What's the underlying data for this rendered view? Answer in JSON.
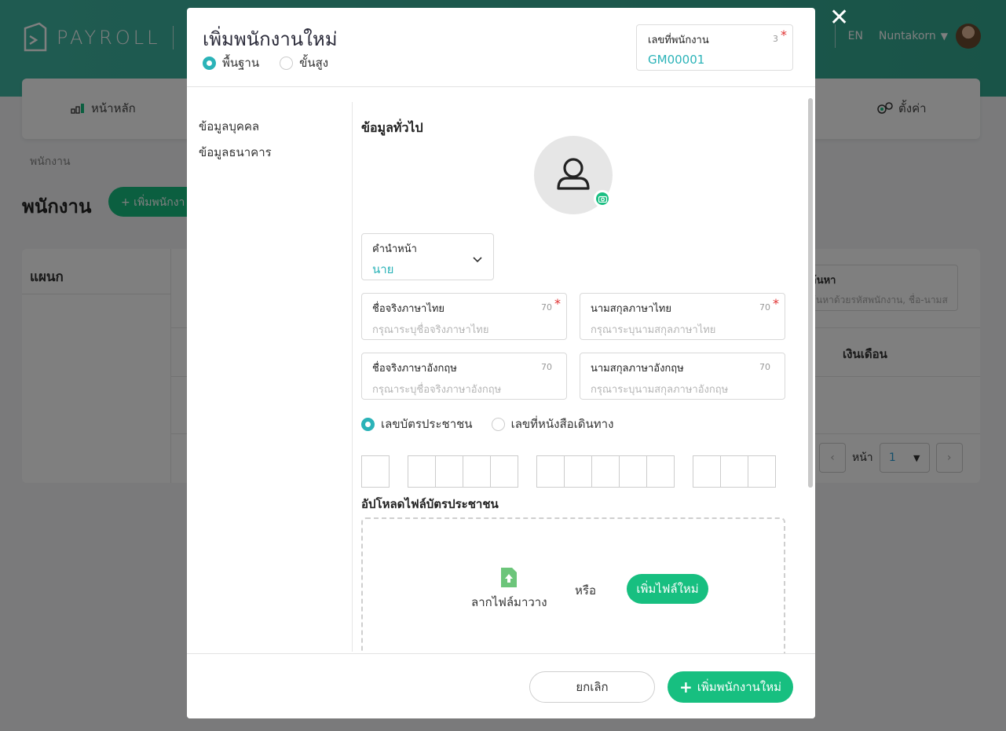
{
  "app": {
    "logo_text": "PAYROLL",
    "lang": "EN",
    "user_name": "Nuntakorn"
  },
  "nav": {
    "home": "หน้าหลัก",
    "settings": "ตั้งค่า"
  },
  "page": {
    "breadcrumb": "พนักงาน",
    "title": "พนักงาน",
    "add_button": "+ เพิ่มพนักงา"
  },
  "table": {
    "dept_header": "แผนก",
    "search_label": "ค้นหา",
    "search_placeholder": "ค้นหาด้วยรหัสพนักงาน, ชื่อ-นามส",
    "salary_header": "เงินเดือน",
    "page_label": "หน้า",
    "page_value": "1"
  },
  "modal": {
    "title": "เพิ่มพนักงานใหม่",
    "close": "✕",
    "modes": [
      "พื้นฐาน",
      "ขั้นสูง"
    ],
    "selected_mode": "พื้นฐาน",
    "employee_no": {
      "label": "เลขที่พนักงาน",
      "value": "GM00001",
      "count": "3"
    },
    "side_nav": [
      "ข้อมูลบุคคล",
      "ข้อมูลธนาคาร"
    ],
    "section_title": "ข้อมูลทั่วไป",
    "prefix": {
      "label": "คำนำหน้า",
      "value": "นาย"
    },
    "first_name_th": {
      "label": "ชื่อจริงภาษาไทย",
      "placeholder": "กรุณาระบุชื่อจริงภาษาไทย",
      "count": "70"
    },
    "last_name_th": {
      "label": "นามสกุลภาษาไทย",
      "placeholder": "กรุณาระบุนามสกุลภาษาไทย",
      "count": "70"
    },
    "first_name_en": {
      "label": "ชื่อจริงภาษาอังกฤษ",
      "placeholder": "กรุณาระบุชื่อจริงภาษาอังกฤษ",
      "count": "70"
    },
    "last_name_en": {
      "label": "นามสกุลภาษาอังกฤษ",
      "placeholder": "กรุณาระบุนามสกุลภาษาอังกฤษ",
      "count": "70"
    },
    "id_types": [
      "เลขบัตรประชาชน",
      "เลขที่หนังสือเดินทาง"
    ],
    "selected_id_type": "เลขบัตรประชาชน",
    "upload": {
      "title": "อัปโหลดไฟล์บัตรประชาชน",
      "drag_text": "ลากไฟล์มาวาง",
      "or_text": "หรือ",
      "button": "เพิ่มไฟล์ใหม่"
    },
    "footer": {
      "cancel": "ยกเลิก",
      "submit": "เพิ่มพนักงานใหม่",
      "submit_icon": "+"
    }
  },
  "colors": {
    "brand_teal": "#3fb7a3",
    "accent_green": "#17bf80",
    "value_teal": "#2bb3b8",
    "required_red": "#e03131"
  }
}
